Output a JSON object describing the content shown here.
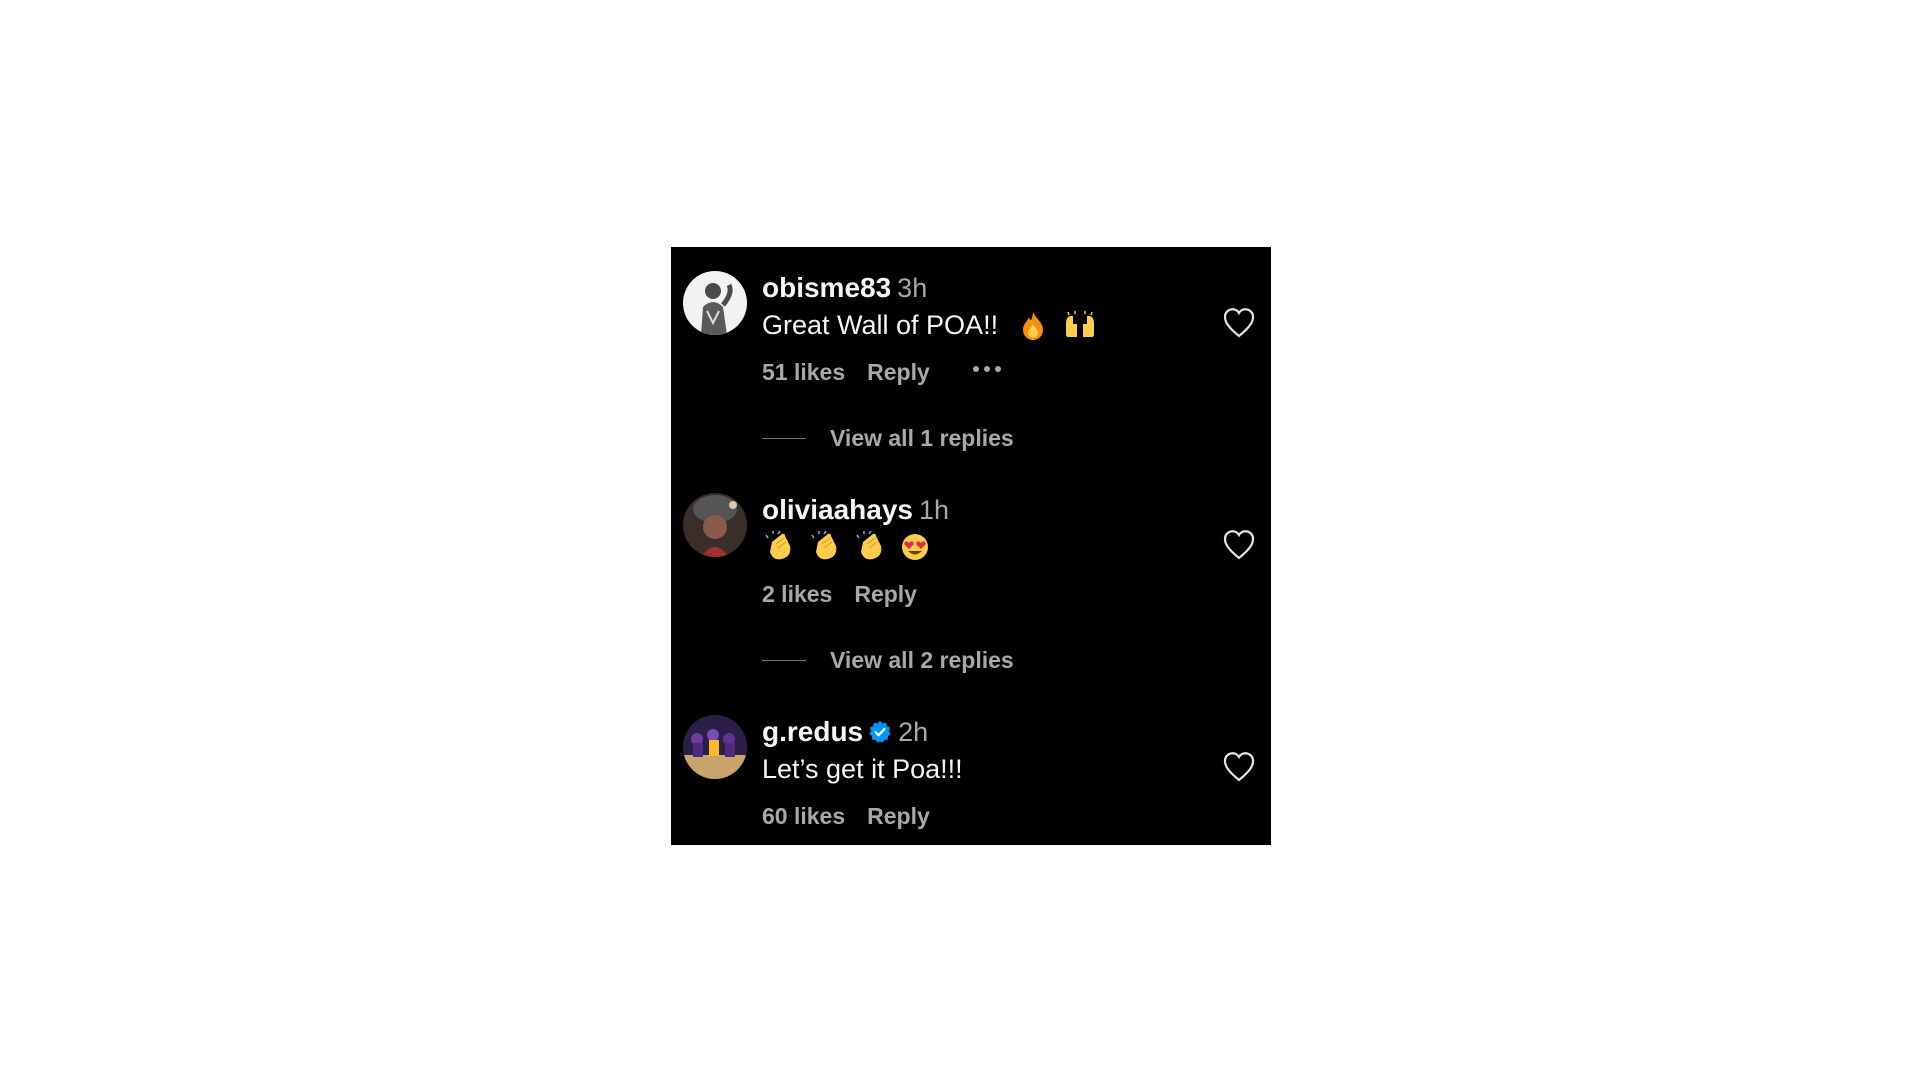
{
  "comments": [
    {
      "username": "obisme83",
      "time": "3h",
      "text": "Great Wall of POA!!",
      "emojis": [
        "fire",
        "raising-hands"
      ],
      "likes": "51 likes",
      "reply": "Reply",
      "has_more": true,
      "view_replies": "View all 1 replies"
    },
    {
      "username": "oliviaahays",
      "time": "1h",
      "text": "",
      "emojis": [
        "clapping-hands",
        "clapping-hands",
        "clapping-hands",
        "heart-eyes"
      ],
      "likes": "2 likes",
      "reply": "Reply",
      "view_replies": "View all 2 replies"
    },
    {
      "username": "g.redus",
      "verified": true,
      "time": "2h",
      "text": "Let’s get it Poa!!!",
      "likes": "60 likes",
      "reply": "Reply"
    }
  ],
  "colors": {
    "background": "#000000",
    "primary_text": "#f5f5f5",
    "secondary_text": "#a8a8a8",
    "verified_badge": "#0095f6"
  },
  "icons": [
    "more-options-icon",
    "heart-icon",
    "verified-badge-icon"
  ]
}
